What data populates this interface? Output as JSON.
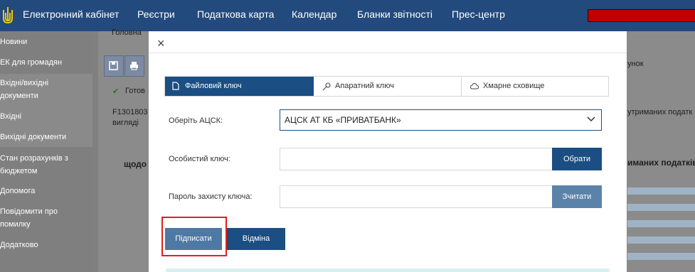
{
  "header": {
    "brand": "Електронний кабінет",
    "nav": [
      "Реєстри",
      "Податкова карта",
      "Календар",
      "Бланки звітності",
      "Прес-центр"
    ]
  },
  "sidebar": {
    "items": [
      {
        "label": "Новини"
      },
      {
        "label": "ЕК для громадян"
      },
      {
        "label": "Вхідні/вихідні"
      },
      {
        "label": "документи"
      },
      {
        "label": "Вхідні"
      },
      {
        "label": "Вихідні документи"
      },
      {
        "label": "Стан розрахунків з"
      },
      {
        "label": "бюджетом"
      },
      {
        "label": "Допомога"
      },
      {
        "label": "Повідомити про"
      },
      {
        "label": "помилку"
      },
      {
        "label": "Додатково"
      }
    ]
  },
  "background": {
    "breadcrumb": "Головна",
    "status": "Готов",
    "doc_code": "F1301803 З",
    "doc_view": "вигляді",
    "heading_left": "щодо",
    "right_top": "унок",
    "right_mid": "утриманих податк",
    "right_heading": "иманих податків"
  },
  "modal": {
    "close": "×",
    "tabs": [
      {
        "label": "Файловий ключ",
        "icon": "file-icon",
        "active": true
      },
      {
        "label": "Апаратний ключ",
        "icon": "key-icon",
        "active": false
      },
      {
        "label": "Хмарне сховище",
        "icon": "cloud-icon",
        "active": false
      }
    ],
    "acsk_label": "Оберіть АЦСК:",
    "acsk_value": "АЦСК АТ КБ «ПРИВАТБАНК»",
    "key_label": "Особистий ключ:",
    "choose_button": "Обрати",
    "password_label": "Пароль захисту ключа:",
    "read_button": "Зчитати",
    "sign_button": "Підписати",
    "cancel_button": "Відміна"
  },
  "colors": {
    "header": "#234a7d",
    "primary": "#1b4e82",
    "highlight": "#e02020"
  }
}
